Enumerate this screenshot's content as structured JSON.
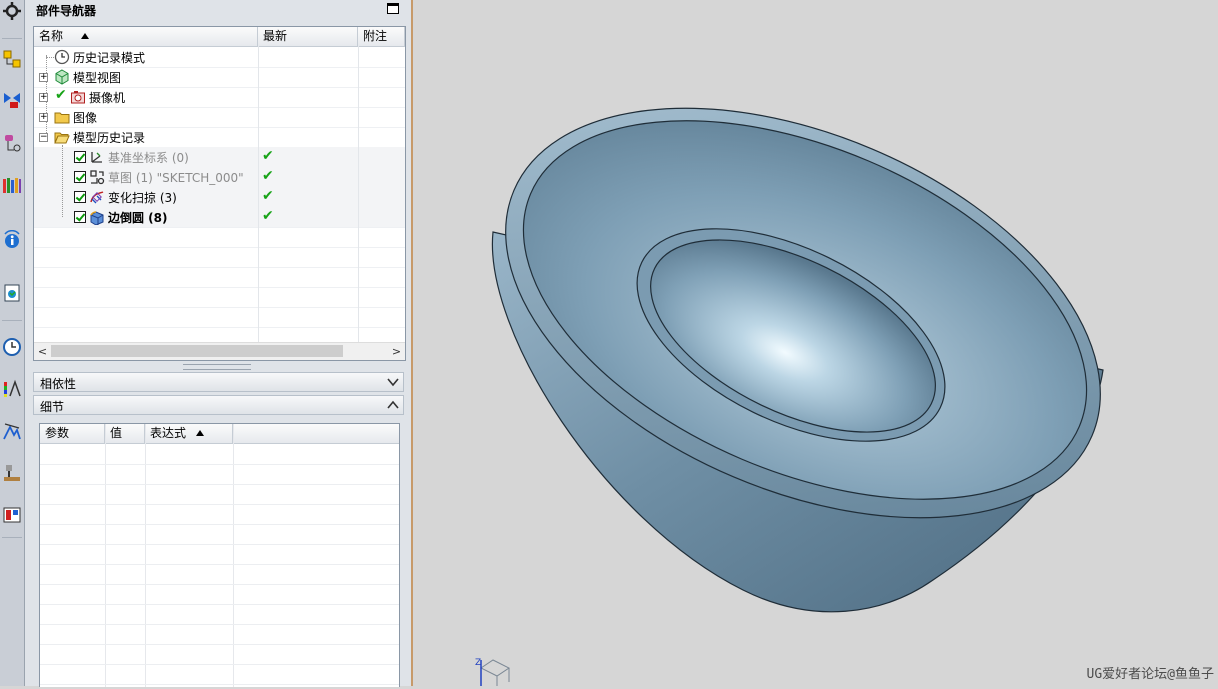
{
  "navigator": {
    "title": "部件导航器",
    "columns": {
      "name": "名称",
      "latest": "最新",
      "note": "附注"
    },
    "nodes": [
      {
        "label": "历史记录模式",
        "style": "normal",
        "icon": "clock-icon"
      },
      {
        "label": "模型视图",
        "style": "normal",
        "icon": "model-view-icon",
        "expander": "+"
      },
      {
        "label": "摄像机",
        "style": "normal",
        "icon": "camera-icon",
        "expander": "+",
        "check": "✔"
      },
      {
        "label": "图像",
        "style": "normal",
        "icon": "folder-icon",
        "expander": "+"
      },
      {
        "label": "模型历史记录",
        "style": "normal",
        "icon": "open-folder-icon",
        "expander": "−"
      },
      {
        "label": "基准坐标系 (0)",
        "style": "gray",
        "icon": "datum-csys-icon",
        "latest": "✔"
      },
      {
        "label": "草图 (1) \"SKETCH_000\"",
        "style": "gray",
        "icon": "sketch-icon",
        "latest": "✔"
      },
      {
        "label": "变化扫掠 (3)",
        "style": "normal",
        "icon": "variational-sweep-icon",
        "latest": "✔"
      },
      {
        "label": "边倒圆 (8)",
        "style": "bold",
        "icon": "edge-blend-icon",
        "latest": "✔"
      }
    ],
    "scroll_left": "<",
    "scroll_right": ">"
  },
  "dependencies": {
    "label": "相依性"
  },
  "details": {
    "label": "细节",
    "columns": {
      "param": "参数",
      "value": "值",
      "expression": "表达式"
    }
  },
  "viewport": {
    "watermark": "UG爱好者论坛@鱼鱼子",
    "triad_z": "Z",
    "model_color": "#7e9fb5"
  },
  "resource_bar": {
    "icons": [
      "settings-icon",
      "assembly-navigator-icon",
      "constraint-navigator-icon",
      "part-navigator-icon",
      "reuse-library-icon",
      "hd3d-icon",
      "web-browser-icon",
      "history-icon",
      "system-materials-icon",
      "process-studio-icon",
      "manufacturing-wizard-icon",
      "roles-icon"
    ]
  }
}
